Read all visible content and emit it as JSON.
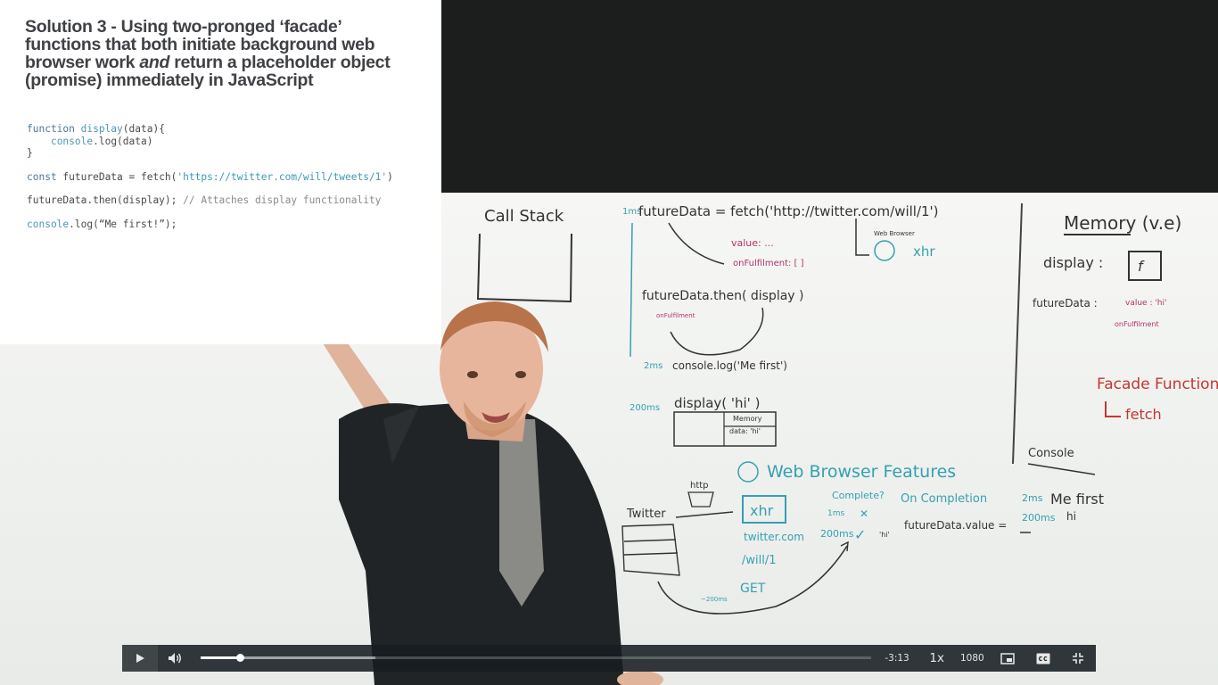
{
  "slide": {
    "title_pre": "Solution 3 - Using two-pronged ‘facade’ functions that both initiate background web browser work ",
    "title_em": "and",
    "title_post": " return a placeholder object (promise) immediately in JavaScript",
    "code": {
      "l1_kw": "function ",
      "l1_fn": "display",
      "l1_rest": "(data){",
      "l2_fn": "console",
      "l2_rest": ".log(data)",
      "l3": "}",
      "l4_kw": "const ",
      "l4_plain": "futureData = fetch(",
      "l4_str": "'https://twitter.com/will/tweets/1'",
      "l4_end": ")",
      "l5_plain": "futureData.then(display); ",
      "l5_cm": "// Attaches display functionality",
      "l6_fn": "console",
      "l6_rest": ".log(“Me first!”);"
    }
  },
  "whiteboard": {
    "call_stack": "Call Stack",
    "memory": "Memory (v.e)",
    "memory_display": "display :",
    "memory_f": "f",
    "memory_futuredata": "futureData :",
    "memory_value": "value : 'hi'",
    "memory_onfulfill": "onFulfilment",
    "fetch_line": "futureData = fetch('http://twitter.com/will/1')",
    "ms1": "1ms",
    "ms2": "2ms",
    "ms200a": "200ms",
    "value_label": "value: ...",
    "onfulfil_label": "onFulfilment: [ ]",
    "then_line": "futureData.then( display )",
    "onfulfil_small": "onFulfilment",
    "console_log_line": "console.log('Me first')",
    "display_hi": "display( 'hi' )",
    "mini_memory": "Memory",
    "mini_data": "data: 'hi'",
    "webbrowser_label": "Web Browser",
    "xhr_small": "xhr",
    "facade_functions": "Facade Functions",
    "fetch_arrow": "fetch",
    "console_title": "Console",
    "console_1ms": "2ms",
    "console_me_first": "Me first",
    "console_200ms": "200ms",
    "console_hi": "hi",
    "web_browser_features": "Web Browser Features",
    "complete": "Complete?",
    "on_completion": "On Completion",
    "xhr": "xhr",
    "http": "http",
    "twitter": "Twitter",
    "twitter_url": "twitter.com",
    "will_path": "/will/1",
    "get": "GET",
    "ms_1": "1ms",
    "ms_200": "200ms",
    "hi_quote": "'hi'",
    "future_value": "futureData.value =",
    "ms_arrow": "~200ms"
  },
  "controls": {
    "time_remaining": "-3:13",
    "speed": "1x",
    "quality": "1080",
    "progress_fraction": 0.058,
    "buffer_fraction": 0.26
  }
}
